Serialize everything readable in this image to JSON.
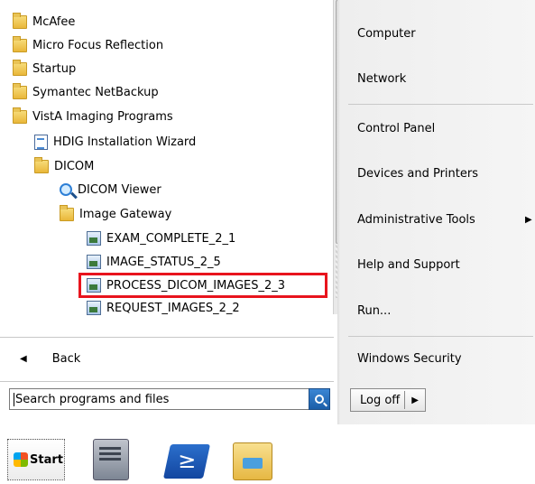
{
  "programs": [
    {
      "label": "McAfee",
      "icon": "folder-icon"
    },
    {
      "label": "Micro Focus Reflection",
      "icon": "folder-icon"
    },
    {
      "label": "Startup",
      "icon": "folder-icon"
    },
    {
      "label": "Symantec NetBackup",
      "icon": "folder-icon"
    },
    {
      "label": "VistA Imaging Programs",
      "icon": "folder-icon"
    },
    {
      "label": "HDIG Installation Wizard",
      "icon": "document-icon"
    },
    {
      "label": "DICOM",
      "icon": "folder-icon"
    },
    {
      "label": "DICOM Viewer",
      "icon": "magnifier-icon"
    },
    {
      "label": "Image Gateway",
      "icon": "folder-icon"
    },
    {
      "label": "EXAM_COMPLETE_2_1",
      "icon": "program-icon"
    },
    {
      "label": "IMAGE_STATUS_2_5",
      "icon": "program-icon"
    },
    {
      "label": "PROCESS_DICOM_IMAGES_2_3",
      "icon": "program-icon"
    },
    {
      "label": "REQUEST_IMAGES_2_2",
      "icon": "program-icon"
    }
  ],
  "back_label": "Back",
  "search": {
    "placeholder": "Search programs and files"
  },
  "right_menu": {
    "computer": "Computer",
    "network": "Network",
    "control_panel": "Control Panel",
    "devices_printers": "Devices and Printers",
    "admin_tools": "Administrative Tools",
    "help_support": "Help and Support",
    "run": "Run...",
    "windows_security": "Windows Security"
  },
  "logoff_label": "Log off",
  "taskbar": {
    "start_label": "Start"
  },
  "colors": {
    "highlight": "#e8141d",
    "accent": "#1b5ea8"
  }
}
